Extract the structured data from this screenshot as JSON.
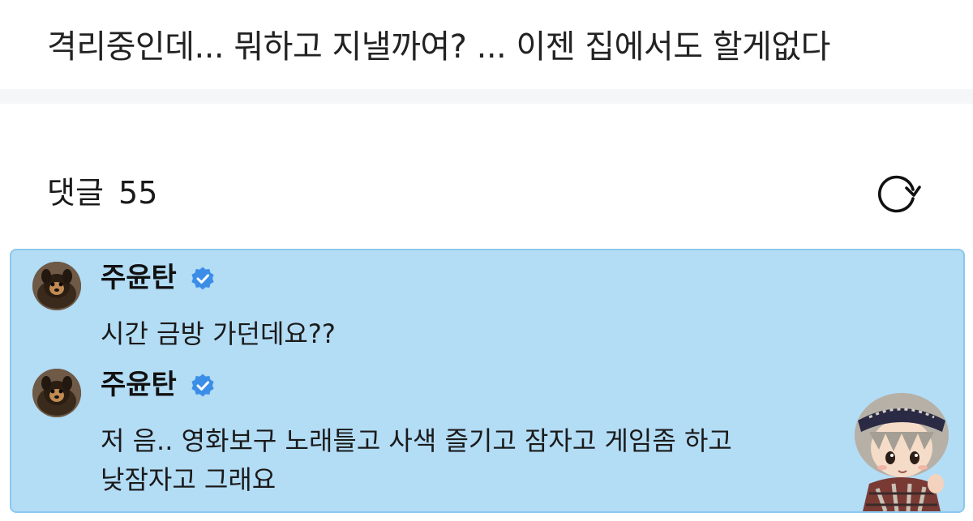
{
  "post": {
    "title": "격리중인데... 뭐하고 지낼까여? ... 이젠 집에서도 할게없다"
  },
  "comments_header": {
    "label": "댓글",
    "count": "55"
  },
  "comments": [
    {
      "username": "주윤탄",
      "verified": true,
      "text": "시간 금방 가던데요??"
    },
    {
      "username": "주윤탄",
      "verified": true,
      "text_lines": [
        "저 음.. 영화보구 노래틀고 사색 즐기고 잠자고 게임좀 하고",
        "낮잠자고 그래요"
      ]
    }
  ],
  "colors": {
    "highlight_bg": "#b3dcf5",
    "highlight_border": "#8cc8ee",
    "verified_badge": "#3b8ee8",
    "divider": "#f4f6f8"
  },
  "icons": {
    "refresh": "refresh-icon",
    "verified": "verified-badge-icon",
    "sticker": "character-sticker"
  }
}
